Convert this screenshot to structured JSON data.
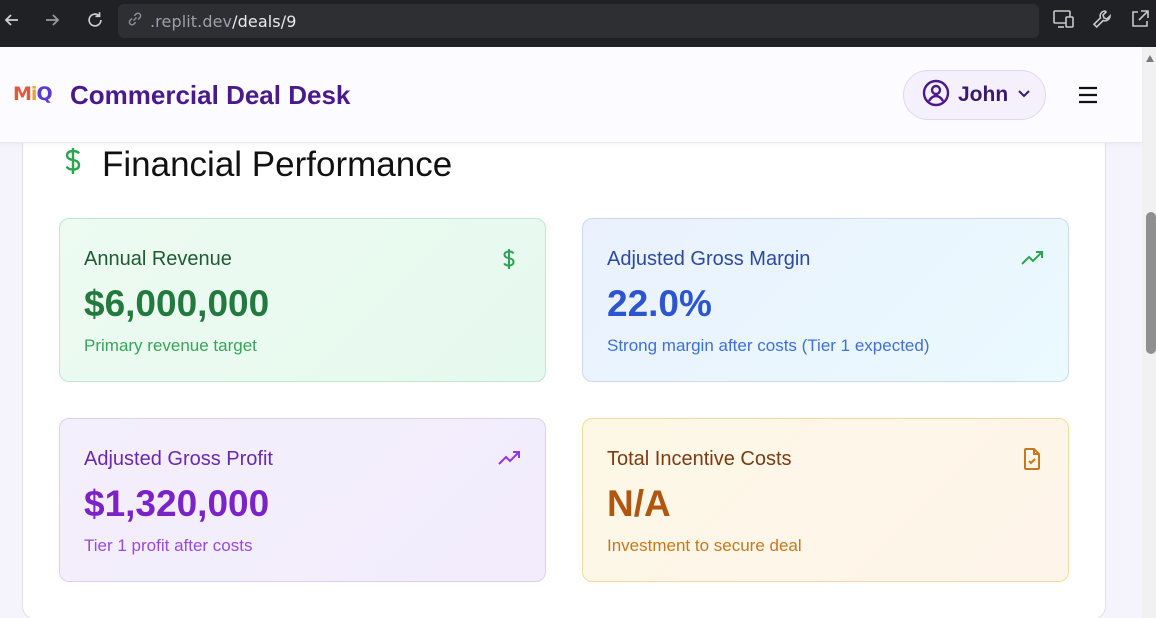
{
  "browser": {
    "url_host": ".replit.dev",
    "url_path": "/deals/9"
  },
  "header": {
    "logo_m": "M",
    "logo_i": "i",
    "logo_q": "Q",
    "title": "Commercial Deal Desk",
    "user_name": "John"
  },
  "section": {
    "title": "Financial Performance",
    "icon": "dollar-icon"
  },
  "metrics": [
    {
      "label": "Annual Revenue",
      "value": "$6,000,000",
      "sub": "Primary revenue target",
      "icon": "dollar-icon",
      "accent": "#237a3e"
    },
    {
      "label": "Adjusted Gross Margin",
      "value": "22.0%",
      "sub": "Strong margin after costs (Tier 1 expected)",
      "icon": "trending-up-icon",
      "accent": "#2d55cf"
    },
    {
      "label": "Adjusted Gross Profit",
      "value": "$1,320,000",
      "sub": "Tier 1 profit after costs",
      "icon": "trending-up-icon",
      "accent": "#7b22c9"
    },
    {
      "label": "Total Incentive Costs",
      "value": "N/A",
      "sub": "Investment to secure deal",
      "icon": "file-check-icon",
      "accent": "#b0560f"
    }
  ]
}
